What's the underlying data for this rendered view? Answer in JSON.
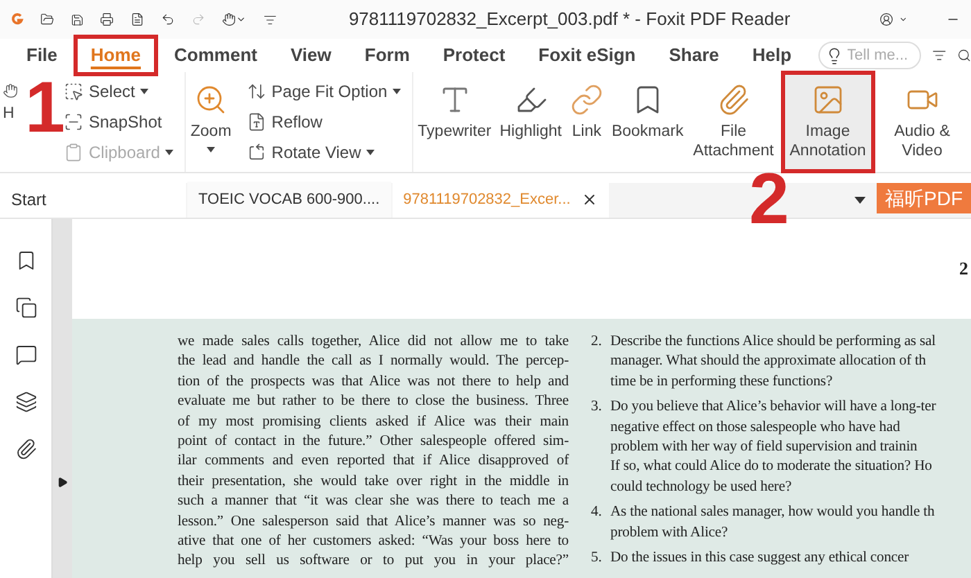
{
  "window": {
    "title": "9781119702832_Excerpt_003.pdf * - Foxit PDF Reader"
  },
  "menu_tabs": [
    {
      "label": "File",
      "selected": false,
      "highlighted": false
    },
    {
      "label": "Home",
      "selected": true,
      "highlighted": true
    },
    {
      "label": "Comment",
      "selected": false,
      "highlighted": false
    },
    {
      "label": "View",
      "selected": false,
      "highlighted": false
    },
    {
      "label": "Form",
      "selected": false,
      "highlighted": false
    },
    {
      "label": "Protect",
      "selected": false,
      "highlighted": false
    },
    {
      "label": "Foxit eSign",
      "selected": false,
      "highlighted": false
    },
    {
      "label": "Share",
      "selected": false,
      "highlighted": false
    },
    {
      "label": "Help",
      "selected": false,
      "highlighted": false
    }
  ],
  "search": {
    "placeholder": "Tell me..."
  },
  "ribbon": [
    {
      "kind": "large",
      "label": "H",
      "highlighted": false
    },
    {
      "kind": "stack",
      "items": [
        {
          "label": "Select",
          "dropdown": true,
          "disabled": false
        },
        {
          "label": "SnapShot",
          "dropdown": false,
          "disabled": false
        },
        {
          "label": "Clipboard",
          "dropdown": true,
          "disabled": true
        }
      ]
    },
    {
      "kind": "large",
      "label": "Zoom",
      "dropdown": true,
      "highlighted": false
    },
    {
      "kind": "stack",
      "items": [
        {
          "label": "Page Fit Option",
          "dropdown": true,
          "disabled": false
        },
        {
          "label": "Reflow",
          "dropdown": false,
          "disabled": false
        },
        {
          "label": "Rotate View",
          "dropdown": true,
          "disabled": false
        }
      ]
    },
    {
      "kind": "large",
      "label": "Typewriter",
      "highlighted": false
    },
    {
      "kind": "large",
      "label": "Highlight",
      "highlighted": false
    },
    {
      "kind": "large",
      "label": "Link",
      "highlighted": false
    },
    {
      "kind": "large",
      "label": "Bookmark",
      "highlighted": false
    },
    {
      "kind": "large",
      "label": "File Attachment",
      "highlighted": false
    },
    {
      "kind": "large",
      "label": "Image Annotation",
      "highlighted": true
    },
    {
      "kind": "large",
      "label": "Audio & Video",
      "highlighted": false
    }
  ],
  "steps": [
    "1",
    "2"
  ],
  "doc_tabs": {
    "start": "Start",
    "tabs": [
      {
        "label": "TOEIC VOCAB 600-900....",
        "selected": false,
        "closable": false
      },
      {
        "label": "9781119702832_Excer...",
        "selected": true,
        "closable": true
      }
    ],
    "badge": "福昕PDF"
  },
  "page": {
    "page_mark": "2",
    "left_lines": [
      "we made sales calls together, Alice did not allow me to take",
      "the lead and handle the call as I normally would. The percep-",
      "tion of the prospects was that Alice was not there to help and",
      "evaluate me but rather to be there to close the business. Three",
      "of my most promising clients asked if Alice was their main",
      "point of contact in the future.” Other salespeople offered sim-",
      "ilar comments and even reported that if Alice disapproved of",
      "their presentation, she would take over right in the middle in",
      "such a manner that “it was clear she was there to teach me a",
      "lesson.” One salesperson said that Alice’s manner was so neg-",
      "ative that one of her customers asked: “Was your boss here to",
      "help you sell us software or to put you in your place?”"
    ],
    "questions": [
      {
        "number": "2.",
        "lines": [
          "Describe the functions Alice should be performing as sal",
          "manager. What should the approximate allocation of th",
          "time be in performing these functions?"
        ]
      },
      {
        "number": "3.",
        "lines": [
          "Do you believe that Alice’s behavior will have a long-ter",
          "negative effect on those salespeople who have had",
          "problem with her way of field supervision and trainin",
          "If so, what could Alice do to moderate the situation? Ho",
          "could technology be used here?"
        ]
      },
      {
        "number": "4.",
        "lines": [
          "As the national sales manager, how would you handle th",
          "problem with Alice?"
        ]
      },
      {
        "number": "5.",
        "lines": [
          "Do the issues in this case suggest any ethical concer"
        ]
      }
    ]
  }
}
